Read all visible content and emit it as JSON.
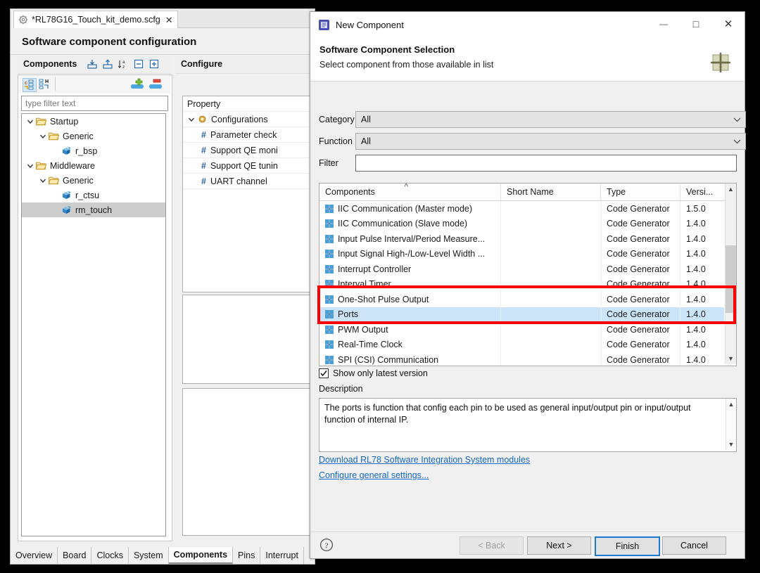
{
  "ide": {
    "tab": {
      "label": "*RL78G16_Touch_kit_demo.scfg",
      "close": "✕",
      "icon": "gear-icon"
    },
    "title": "Software component configuration",
    "components_panel": {
      "title": "Components",
      "header_icons": [
        "import-icon",
        "export-icon",
        "sort-az-icon",
        "collapse-all-icon",
        "expand-all-icon"
      ],
      "tool_icons": [
        "show-c-icon",
        "show-h-icon",
        "add-component-icon",
        "remove-component-icon"
      ],
      "filter_placeholder": "type filter text",
      "tree": [
        {
          "label": "Startup",
          "depth": 0,
          "kind": "folder",
          "expanded": true,
          "selected": false
        },
        {
          "label": "Generic",
          "depth": 1,
          "kind": "folder",
          "expanded": true,
          "selected": false
        },
        {
          "label": "r_bsp",
          "depth": 2,
          "kind": "component",
          "expanded": null,
          "selected": false
        },
        {
          "label": "Middleware",
          "depth": 0,
          "kind": "folder",
          "expanded": true,
          "selected": false
        },
        {
          "label": "Generic",
          "depth": 1,
          "kind": "folder",
          "expanded": true,
          "selected": false
        },
        {
          "label": "r_ctsu",
          "depth": 2,
          "kind": "component",
          "expanded": null,
          "selected": false
        },
        {
          "label": "rm_touch",
          "depth": 2,
          "kind": "component",
          "expanded": null,
          "selected": true
        }
      ]
    },
    "configure_panel": {
      "title": "Configure",
      "property_header": "Property",
      "rows": [
        {
          "label": "Configurations",
          "depth": 0,
          "kind": "config",
          "expanded": true
        },
        {
          "label": "Parameter check",
          "depth": 1,
          "kind": "hash",
          "expanded": null
        },
        {
          "label": "Support QE moni",
          "depth": 1,
          "kind": "hash",
          "expanded": null
        },
        {
          "label": "Support QE tunin",
          "depth": 1,
          "kind": "hash",
          "expanded": null
        },
        {
          "label": "UART channel",
          "depth": 1,
          "kind": "hash",
          "expanded": null
        }
      ]
    },
    "bottom_tabs": [
      {
        "label": "Overview",
        "active": false
      },
      {
        "label": "Board",
        "active": false
      },
      {
        "label": "Clocks",
        "active": false
      },
      {
        "label": "System",
        "active": false
      },
      {
        "label": "Components",
        "active": true
      },
      {
        "label": "Pins",
        "active": false
      },
      {
        "label": "Interrupt",
        "active": false
      }
    ]
  },
  "dialog": {
    "window_title": "New Component",
    "window_icon": "new-component-icon",
    "window_buttons": {
      "minimize": "—",
      "maximize": "□",
      "close": "✕"
    },
    "heading": "Software Component Selection",
    "subheading": "Select component from those available in list",
    "brand_icon": "renesas-logo-icon",
    "fields": {
      "category_label": "Category",
      "category_value": "All",
      "function_label": "Function",
      "function_value": "All",
      "filter_label": "Filter",
      "filter_value": ""
    },
    "table": {
      "columns": [
        "Components",
        "Short Name",
        "Type",
        "Versi..."
      ],
      "sort_column": "Components",
      "sort_indicator": "˄",
      "rows": [
        {
          "name": "IIC Communication (Master mode)",
          "short": "",
          "type": "Code Generator",
          "version": "1.5.0",
          "selected": false
        },
        {
          "name": "IIC Communication (Slave mode)",
          "short": "",
          "type": "Code Generator",
          "version": "1.4.0",
          "selected": false
        },
        {
          "name": "Input Pulse Interval/Period Measure...",
          "short": "",
          "type": "Code Generator",
          "version": "1.4.0",
          "selected": false
        },
        {
          "name": "Input Signal High-/Low-Level Width ...",
          "short": "",
          "type": "Code Generator",
          "version": "1.4.0",
          "selected": false
        },
        {
          "name": "Interrupt Controller",
          "short": "",
          "type": "Code Generator",
          "version": "1.4.0",
          "selected": false
        },
        {
          "name": "Interval Timer",
          "short": "",
          "type": "Code Generator",
          "version": "1.4.0",
          "selected": false
        },
        {
          "name": "One-Shot Pulse Output",
          "short": "",
          "type": "Code Generator",
          "version": "1.4.0",
          "selected": false
        },
        {
          "name": "Ports",
          "short": "",
          "type": "Code Generator",
          "version": "1.4.0",
          "selected": true
        },
        {
          "name": "PWM Output",
          "short": "",
          "type": "Code Generator",
          "version": "1.4.0",
          "selected": false
        },
        {
          "name": "Real-Time Clock",
          "short": "",
          "type": "Code Generator",
          "version": "1.4.0",
          "selected": false
        },
        {
          "name": "SPI (CSI) Communication",
          "short": "",
          "type": "Code Generator",
          "version": "1.4.0",
          "selected": false
        }
      ]
    },
    "show_latest_label": "Show only latest version",
    "show_latest_checked": true,
    "description_label": "Description",
    "description_text": "The ports is function that config each pin to be used as general input/output pin or input/output function of internal IP.",
    "links": [
      "Download RL78 Software Integration System modules",
      "Configure general settings..."
    ],
    "footer": {
      "help_icon": "help-icon",
      "back": "< Back",
      "next": "Next >",
      "finish": "Finish",
      "cancel": "Cancel",
      "back_enabled": false,
      "default_button": "Finish"
    }
  },
  "annotation": {
    "highlight_color": "#fb0000",
    "shape": "rectangle",
    "target_rows": [
      "One-Shot Pulse Output",
      "Ports",
      "PWM Output"
    ]
  }
}
